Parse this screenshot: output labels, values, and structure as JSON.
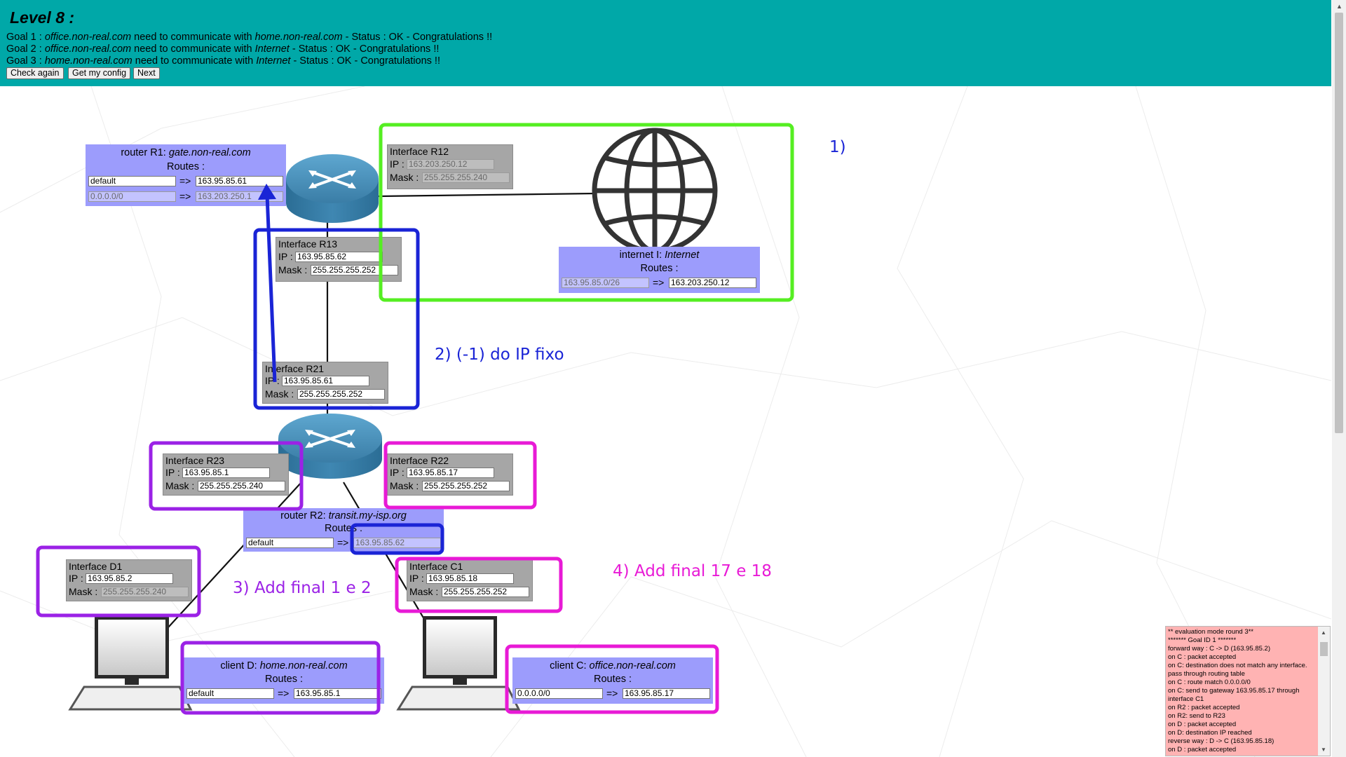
{
  "header": {
    "level_title": "Level 8 :",
    "goals": [
      {
        "prefix": "Goal 1 : ",
        "from": "office.non-real.com",
        "mid": " need to communicate with ",
        "to": "home.non-real.com",
        "status": " - Status : OK - Congratulations !!"
      },
      {
        "prefix": "Goal 2 : ",
        "from": "office.non-real.com",
        "mid": " need to communicate with ",
        "to": "Internet",
        "status": " - Status : OK - Congratulations !!"
      },
      {
        "prefix": "Goal 3 : ",
        "from": "home.non-real.com",
        "mid": " need to communicate with ",
        "to": "Internet",
        "status": " - Status : OK - Congratulations !!"
      }
    ],
    "buttons": {
      "check_again": "Check again",
      "get_config": "Get my config",
      "next": "Next"
    }
  },
  "labels": {
    "routes": "Routes :",
    "ip": "IP :",
    "mask": "Mask :",
    "arrow": "=>"
  },
  "router_r1": {
    "type": "router R1: ",
    "name": "gate.non-real.com",
    "routes": [
      {
        "dest": "default",
        "gateway": "163.95.85.61",
        "editable": true
      },
      {
        "dest": "0.0.0.0/0",
        "gateway": "163.203.250.1",
        "editable": false
      }
    ]
  },
  "router_r2": {
    "type": "router R2: ",
    "name": "transit.my-isp.org",
    "routes": [
      {
        "dest": "default",
        "gateway": "163.95.85.62"
      }
    ]
  },
  "internet": {
    "type": "internet I: ",
    "name": "Internet",
    "routes": [
      {
        "dest": "163.95.85.0/26",
        "gateway": "163.203.250.12"
      }
    ]
  },
  "client_d": {
    "type": "client D: ",
    "name": "home.non-real.com",
    "routes": [
      {
        "dest": "default",
        "gateway": "163.95.85.1"
      }
    ]
  },
  "client_c": {
    "type": "client C: ",
    "name": "office.non-real.com",
    "routes": [
      {
        "dest": "0.0.0.0/0",
        "gateway": "163.95.85.17"
      }
    ]
  },
  "interfaces": {
    "r12": {
      "title": "Interface R12",
      "ip": "163.203.250.12",
      "mask": "255.255.255.240"
    },
    "r13": {
      "title": "Interface R13",
      "ip": "163.95.85.62",
      "mask": "255.255.255.252"
    },
    "r21": {
      "title": "Interface R21",
      "ip": "163.95.85.61",
      "mask": "255.255.255.252"
    },
    "r23": {
      "title": "Interface R23",
      "ip": "163.95.85.1",
      "mask": "255.255.255.240"
    },
    "r22": {
      "title": "Interface R22",
      "ip": "163.95.85.17",
      "mask": "255.255.255.252"
    },
    "d1": {
      "title": "Interface D1",
      "ip": "163.95.85.2",
      "mask": "255.255.255.240"
    },
    "c1": {
      "title": "Interface C1",
      "ip": "163.95.85.18",
      "mask": "255.255.255.252"
    }
  },
  "annotations": {
    "a1": "1)",
    "a2": "2) (-1) do IP fixo",
    "a3": "3) Add final 1 e 2",
    "a4": "4) Add final 17 e 18"
  },
  "colors": {
    "header": "#00a8a8",
    "panel": "#9c9cfc",
    "annot_green": "#55ee22",
    "annot_blue": "#1a24d6",
    "annot_purple": "#9b22e6",
    "annot_magenta": "#e81ad6",
    "log_bg": "#ffb3b3"
  },
  "log": {
    "lines": [
      "** evaluation mode round 3**",
      "******* Goal ID 1 *******",
      "forward way : C -> D (163.95.85.2)",
      "on C : packet accepted",
      "on C: destination does not match any interface. pass through routing table",
      "on C : route match 0.0.0.0/0",
      "on C: send to gateway 163.95.85.17 through interface C1",
      "on R2 : packet accepted",
      "on R2: send to R23",
      "on D : packet accepted",
      "on D: destination IP reached",
      "reverse way : D -> C (163.95.85.18)",
      "on D : packet accepted"
    ]
  }
}
